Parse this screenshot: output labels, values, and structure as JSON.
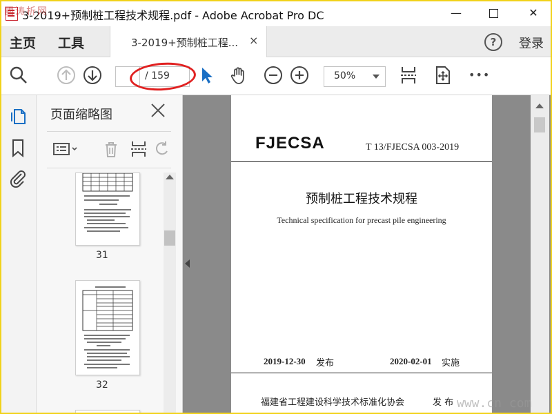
{
  "window": {
    "title": "3-2019+预制桩工程技术规程.pdf - Adobe Acrobat Pro DC",
    "minimize": "—",
    "close": "✕"
  },
  "menubar": {
    "home": "主页",
    "tools": "工具",
    "tab_label": "3-2019+预制桩工程...",
    "tab_close": "×",
    "help": "?",
    "signin": "登录"
  },
  "toolbar": {
    "page_current": "",
    "page_total": "/ 159",
    "zoom": "50%",
    "more": "•••"
  },
  "thumbnails_panel": {
    "title": "页面缩略图",
    "pages": [
      {
        "label": "31"
      },
      {
        "label": "32"
      }
    ]
  },
  "document": {
    "logo": "FJECSA",
    "standard_code": "T 13/FJECSA 003-2019",
    "title_cn": "预制桩工程技术规程",
    "title_en": "Technical specification for precast pile engineering",
    "publish_date": "2019-12-30",
    "publish_word": "发布",
    "effective_date": "2020-02-01",
    "effective_word": "实施",
    "issuer": "福建省工程建设科学技术标准化协会",
    "issue_word": "发 布"
  },
  "watermarks": {
    "top_left": "國涛析网",
    "bottom_right": "www.cn  com"
  },
  "colors": {
    "accent_blue": "#1a6fc4",
    "annotation_red": "#e02020",
    "frame_yellow": "#f1d21a"
  },
  "icons": {
    "search": "search-icon",
    "prev_page": "arrow-up-circle-icon",
    "next_page": "arrow-down-circle-icon",
    "select": "pointer-icon",
    "hand": "hand-icon",
    "zoom_out": "minus-circle-icon",
    "zoom_in": "plus-circle-icon"
  }
}
